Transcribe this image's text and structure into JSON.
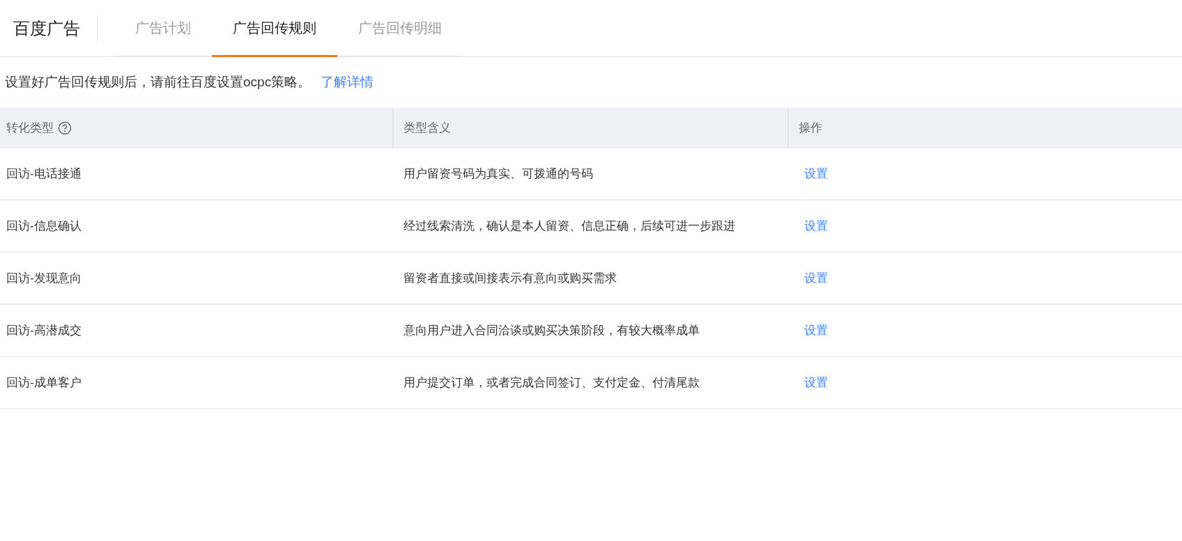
{
  "brand": "百度广告",
  "tabs": [
    {
      "label": "广告计划",
      "selected": false
    },
    {
      "label": "广告回传规则",
      "selected": true
    },
    {
      "label": "广告回传明细",
      "selected": false
    }
  ],
  "notice": {
    "text": "设置好广告回传规则后，请前往百度设置ocpc策略。",
    "link": "了解详情"
  },
  "table": {
    "columns": [
      "转化类型",
      "类型含义",
      "操作"
    ],
    "rows": [
      {
        "type": "回访-电话接通",
        "meaning": "用户留资号码为真实、可拨通的号码",
        "action": "设置"
      },
      {
        "type": "回访-信息确认",
        "meaning": "经过线索清洗，确认是本人留资、信息正确，后续可进一步跟进",
        "action": "设置"
      },
      {
        "type": "回访-发现意向",
        "meaning": "留资者直接或间接表示有意向或购买需求",
        "action": "设置"
      },
      {
        "type": "回访-高潜成交",
        "meaning": "意向用户进入合同洽谈或购买决策阶段，有较大概率成单",
        "action": "设置"
      },
      {
        "type": "回访-成单客户",
        "meaning": "用户提交订单，或者完成合同签订、支付定金、付清尾款",
        "action": "设置"
      }
    ]
  }
}
